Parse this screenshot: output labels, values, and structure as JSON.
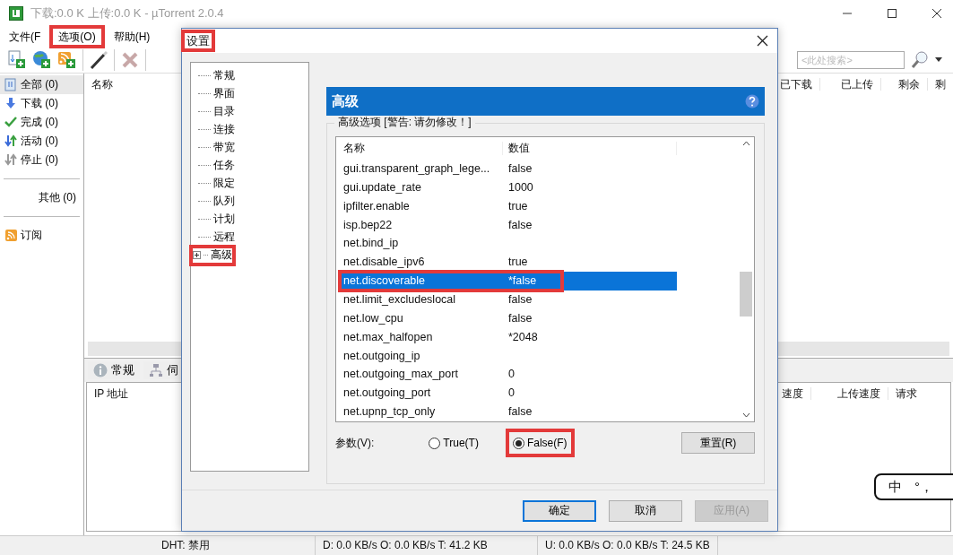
{
  "window": {
    "title": "下载:0.0 K 上传:0.0 K - µTorrent 2.0.4"
  },
  "menu": [
    {
      "label": "文件(F",
      "highlighted": false
    },
    {
      "label": "选项(O)",
      "highlighted": true
    },
    {
      "label": "帮助(H)",
      "highlighted": false
    }
  ],
  "search": {
    "placeholder": "<此处搜索>"
  },
  "sidebar": {
    "items": [
      {
        "label": "全部 (0)",
        "kind": "all",
        "selected": true
      },
      {
        "label": "下载 (0)",
        "kind": "download",
        "selected": false
      },
      {
        "label": "完成 (0)",
        "kind": "complete",
        "selected": false
      },
      {
        "label": "活动 (0)",
        "kind": "active",
        "selected": false
      },
      {
        "label": "停止 (0)",
        "kind": "stopped",
        "selected": false
      },
      {
        "label": "其他 (0)",
        "kind": "other",
        "selected": false
      },
      {
        "label": "订阅",
        "kind": "feed",
        "selected": false
      }
    ]
  },
  "torrent_list": {
    "columns": [
      "名称",
      "已下载",
      "已上传",
      "剩余",
      "剩"
    ]
  },
  "detail_tabs": [
    {
      "label": "常规",
      "kind": "info"
    },
    {
      "label": "伺",
      "kind": "network"
    }
  ],
  "peers": {
    "columns": [
      "IP 地址",
      "速度",
      "上传速度",
      "请求"
    ]
  },
  "status_bar": [
    "DHT: 禁用",
    "D: 0.0 KB/s O: 0.0 KB/s T: 41.2 KB",
    "U: 0.0 KB/s O: 0.0 KB/s T: 24.5 KB"
  ],
  "ime_bar": [
    "中",
    "°，"
  ],
  "dialog": {
    "title": "设置",
    "highlighted": true,
    "tree": [
      {
        "label": "常规",
        "highlighted": false
      },
      {
        "label": "界面",
        "highlighted": false
      },
      {
        "label": "目录",
        "highlighted": false
      },
      {
        "label": "连接",
        "highlighted": false
      },
      {
        "label": "带宽",
        "highlighted": false
      },
      {
        "label": "任务",
        "highlighted": false
      },
      {
        "label": "限定",
        "highlighted": false
      },
      {
        "label": "队列",
        "highlighted": false
      },
      {
        "label": "计划",
        "highlighted": false
      },
      {
        "label": "远程",
        "highlighted": false
      },
      {
        "label": "高级",
        "expanded": false,
        "highlighted": true
      }
    ],
    "header": "高级",
    "group_label": "高级选项 [警告: 请勿修改！]",
    "columns": [
      "名称",
      "数值"
    ],
    "rows": [
      {
        "name": "gui.transparent_graph_lege...",
        "value": "false",
        "selected": false,
        "highlighted": false
      },
      {
        "name": "gui.update_rate",
        "value": "1000",
        "selected": false,
        "highlighted": false
      },
      {
        "name": "ipfilter.enable",
        "value": "true",
        "selected": false,
        "highlighted": false
      },
      {
        "name": "isp.bep22",
        "value": "false",
        "selected": false,
        "highlighted": false
      },
      {
        "name": "net.bind_ip",
        "selected": false,
        "highlighted": false
      },
      {
        "name": "net.disable_ipv6",
        "value": "true",
        "selected": false,
        "highlighted": false
      },
      {
        "name": "net.discoverable",
        "value": "*false",
        "selected": true,
        "highlighted": true
      },
      {
        "name": "net.limit_excludeslocal",
        "value": "false",
        "selected": false,
        "highlighted": false
      },
      {
        "name": "net.low_cpu",
        "value": "false",
        "selected": false,
        "highlighted": false
      },
      {
        "name": "net.max_halfopen",
        "value": "*2048",
        "selected": false,
        "highlighted": false
      },
      {
        "name": "net.outgoing_ip",
        "selected": false,
        "highlighted": false
      },
      {
        "name": "net.outgoing_max_port",
        "value": "0",
        "selected": false,
        "highlighted": false
      },
      {
        "name": "net.outgoing_port",
        "value": "0",
        "selected": false,
        "highlighted": false
      },
      {
        "name": "net.upnp_tcp_only",
        "value": "false",
        "selected": false,
        "highlighted": false
      }
    ],
    "param_label": "参数(V):",
    "options": [
      {
        "label": "True(T)",
        "selected": false,
        "highlighted": false
      },
      {
        "label": "False(F)",
        "selected": true,
        "highlighted": true
      }
    ],
    "reset_button": "重置(R)",
    "buttons": [
      {
        "label": "确定",
        "kind": "default",
        "disabled": false
      },
      {
        "label": "取消",
        "kind": "normal",
        "disabled": false
      },
      {
        "label": "应用(A)",
        "kind": "normal",
        "disabled": true
      }
    ]
  }
}
